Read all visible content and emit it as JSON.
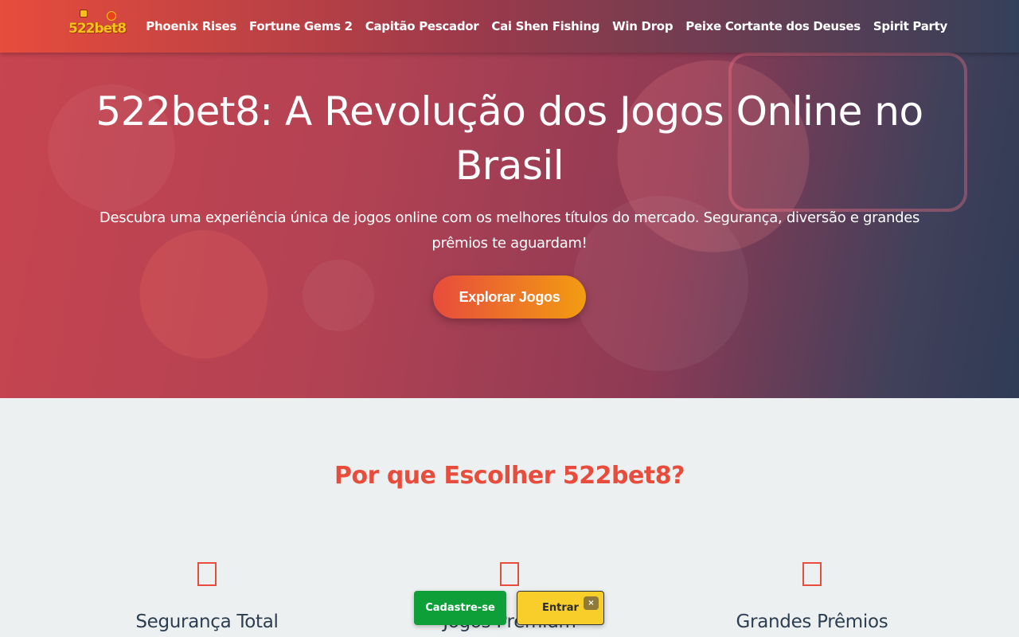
{
  "nav": {
    "logo_text": "522bet8",
    "links": [
      "Phoenix Rises",
      "Fortune Gems 2",
      "Capitão Pescador",
      "Cai Shen Fishing",
      "Win Drop",
      "Peixe Cortante dos Deuses",
      "Spirit Party"
    ]
  },
  "hero": {
    "title": "522bet8: A Revolução dos Jogos Online no Brasil",
    "subtitle": "Descubra uma experiência única de jogos online com os melhores títulos do mercado. Segurança, diversão e grandes prêmios te aguardam!",
    "cta_label": "Explorar Jogos"
  },
  "why": {
    "title": "Por que Escolher 522bet8?",
    "features": [
      {
        "title": "Segurança Total"
      },
      {
        "title": "Jogos Premium"
      },
      {
        "title": "Grandes Prêmios"
      }
    ]
  },
  "floating": {
    "register_label": "Cadastre-se",
    "login_label": "Entrar",
    "close_label": "×"
  },
  "colors": {
    "accent": "#e74c3c",
    "cta_end": "#f39c12",
    "register_green": "#0e9f39",
    "login_yellow": "#f8ce2b",
    "heading_dark": "#2c3e50"
  }
}
